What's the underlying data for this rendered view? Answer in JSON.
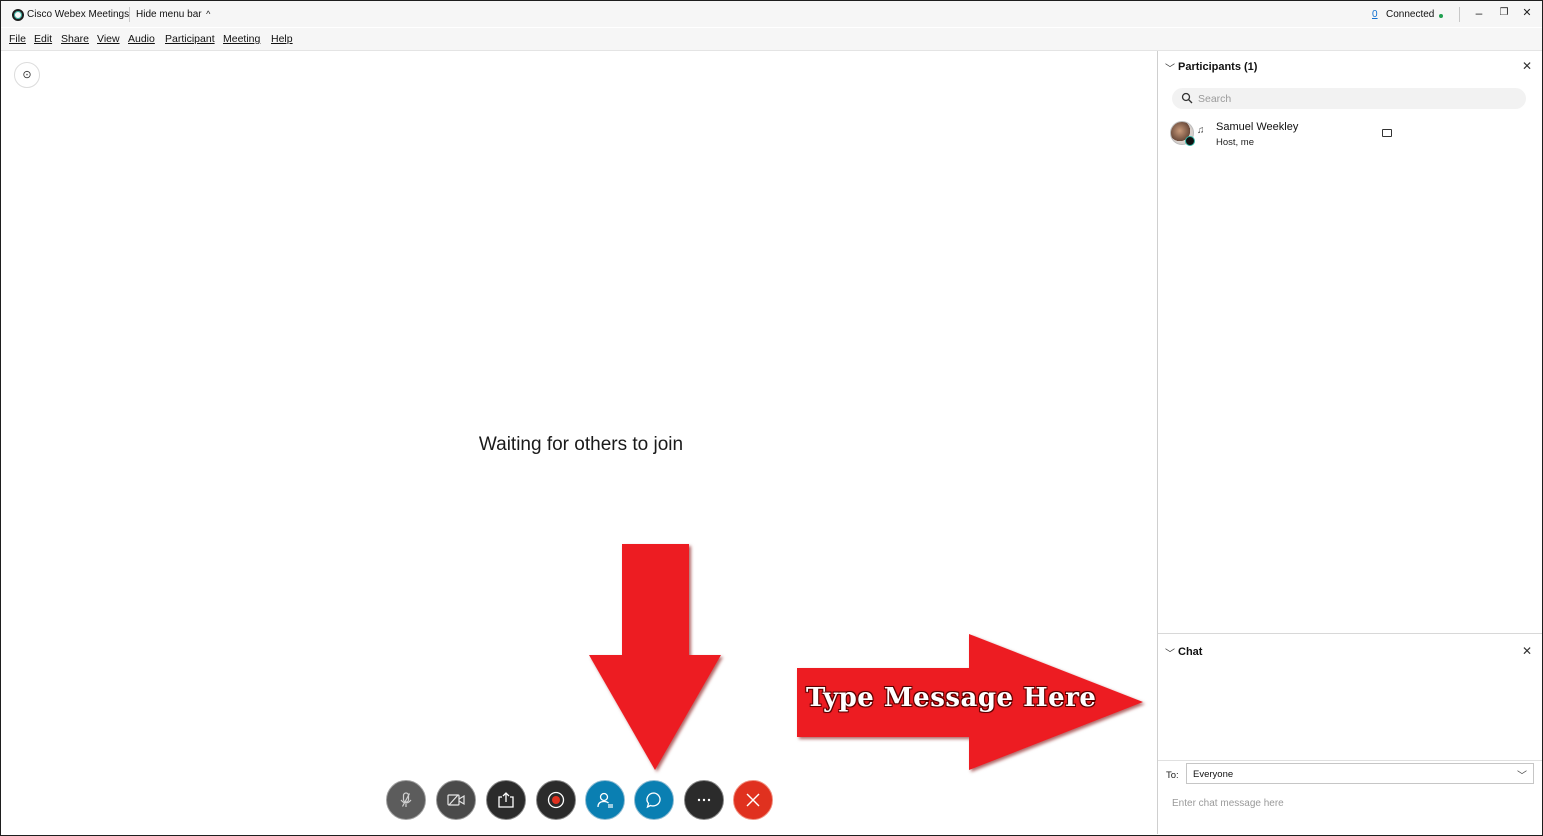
{
  "window": {
    "app_title": "Cisco Webex Meetings",
    "hide_menu_label": "Hide menu bar",
    "connection_icon": "0",
    "connection_label": "Connected",
    "connection_color": "#20a050",
    "minimize": "–",
    "restore": "🗗",
    "close": "✕"
  },
  "menu": {
    "items": [
      "File",
      "Edit",
      "Share",
      "View",
      "Audio",
      "Participant",
      "Meeting",
      "Help"
    ]
  },
  "stage": {
    "waiting_text": "Waiting for others to join",
    "toggle_icon": "⊙"
  },
  "controls": [
    {
      "name": "mute",
      "icon": "microphone-off-icon",
      "color": "#5c5c5c"
    },
    {
      "name": "video",
      "icon": "camera-off-icon",
      "color": "#4a4a4a"
    },
    {
      "name": "share",
      "icon": "share-icon",
      "color": "#2b2b2b"
    },
    {
      "name": "record",
      "icon": "record-icon",
      "color": "#2b2b2b"
    },
    {
      "name": "participants",
      "icon": "participants-icon",
      "color": "#0a7fb2"
    },
    {
      "name": "chat",
      "icon": "chat-icon",
      "color": "#0a7fb2"
    },
    {
      "name": "more",
      "icon": "more-icon",
      "color": "#2b2b2b"
    },
    {
      "name": "leave",
      "icon": "leave-icon",
      "color": "#e0311f"
    }
  ],
  "annotation": {
    "text": "Type Message Here",
    "arrow_color": "#ed1c24"
  },
  "participants_panel": {
    "title": "Participants (1)",
    "search_placeholder": "Search",
    "participants": [
      {
        "name": "Samuel Weekley",
        "role": "Host, me"
      }
    ]
  },
  "chat_panel": {
    "title": "Chat",
    "to_label": "To:",
    "to_value": "Everyone",
    "input_placeholder": "Enter chat message here"
  }
}
